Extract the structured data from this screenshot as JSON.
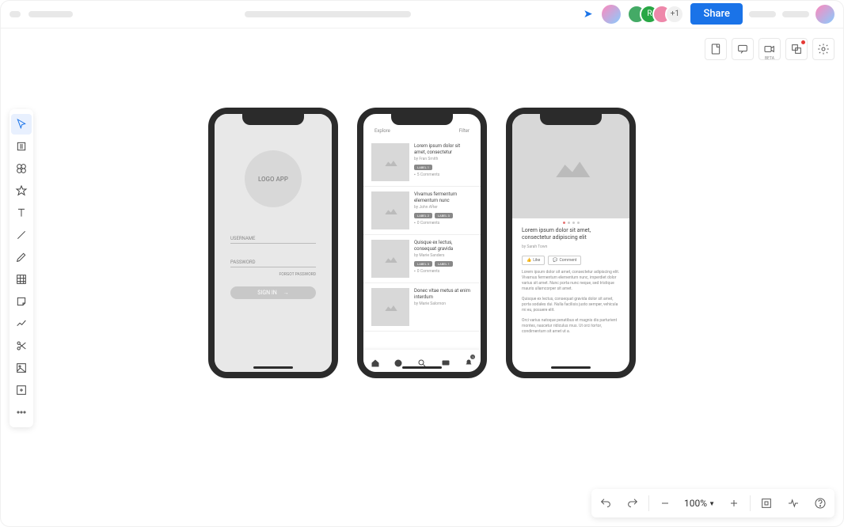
{
  "topbar": {
    "share_label": "Share",
    "overflow_badge": "+1"
  },
  "right_toolbar": {
    "beta_label": "BETA"
  },
  "login": {
    "logo_text": "LOGO APP",
    "username_label": "USERNAME",
    "password_label": "PASSWORD",
    "forgot_label": "FORGOT PASSWORD",
    "signin_label": "SIGN IN"
  },
  "list_screen": {
    "explore_label": "Explore",
    "filter_label": "Filter",
    "items": [
      {
        "title": "Lorem ipsum dolor sit amet, consectetur",
        "author": "by Fran Smith",
        "labels": [
          "LABEL 1"
        ],
        "comments": "5 Comments"
      },
      {
        "title": "Vivamus fermentum elementum nunc",
        "author": "by John After",
        "labels": [
          "LABEL 2",
          "LABEL 3"
        ],
        "comments": "0 Comments"
      },
      {
        "title": "Quisque ex lectus, consequat gravida",
        "author": "by Marie Sanders",
        "labels": [
          "LABEL 3",
          "LABEL 1"
        ],
        "comments": "0 Comments"
      },
      {
        "title": "Donec vitae metus at enim interdum",
        "author": "by Marie Salomon",
        "labels": [],
        "comments": ""
      }
    ],
    "nav_badge": "1"
  },
  "detail_screen": {
    "title": "Lorem ipsum dolor sit amet, consectetur adipiscing elit",
    "author": "by Sarah Town",
    "like_label": "Like",
    "comment_label": "Comment",
    "para1": "Lorem ipsum dolor sit amet, consectetur adipiscing elit. Vivamus fermentum elementum nunc, imperdiet dolor varius sit amet. Nunc porta nunc neque, sed tristique mauris ullamcorper sit amet.",
    "para2": "Quisque ex lectus, consequat gravida dolor sit amet, porta sodales dui. Nulla facilisis justo semper, vehicula mi eu, posuere elit.",
    "para3": "Orci varius natoque penatibus et magnis dis parturient montes, nascetur ridiculus mus. Ut orci tortor, condimentum sit amet ut a."
  },
  "bottombar": {
    "zoom_label": "100%"
  }
}
